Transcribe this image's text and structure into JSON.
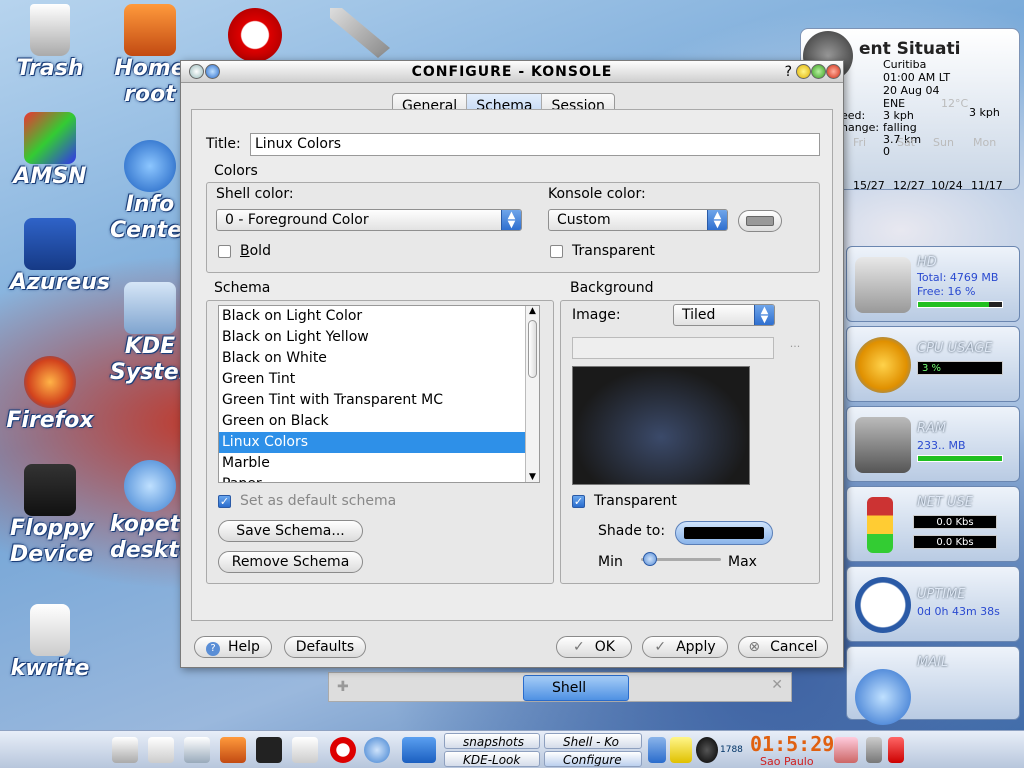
{
  "desktop": {
    "icons": [
      {
        "label": "Trash"
      },
      {
        "label": "Home root"
      },
      {
        "label": "AMSN"
      },
      {
        "label": "Info Center"
      },
      {
        "label": "Azureus"
      },
      {
        "label": "KDE System"
      },
      {
        "label": "Firefox"
      },
      {
        "label": "Floppy Device"
      },
      {
        "label": "kopete desktop"
      },
      {
        "label": "kwrite"
      }
    ]
  },
  "weather": {
    "title": "ent Situati",
    "city": "Curitiba",
    "time": "01:00 AM LT",
    "date": "20 Aug 04",
    "wind_dir": "ENE",
    "temp": "12°C",
    "speed_label": "eed:",
    "speed": "3 kph",
    "change_label": "hange:",
    "change": "falling",
    "visibility": "3.7 km",
    "extra": "0",
    "wind_speed": "3 kph",
    "days": [
      "Fri",
      "Sat",
      "Sun",
      "Mon"
    ],
    "ranges": [
      "15/27",
      "12/27",
      "10/24",
      "11/17"
    ]
  },
  "widgets": {
    "hd": {
      "title": "HD",
      "total": "Total: 4769 MB",
      "free": "Free: 16 %",
      "used_fraction": 0.84
    },
    "cpu": {
      "title": "CPU USAGE",
      "value": "3 %"
    },
    "ram": {
      "title": "RAM",
      "value": "233.. MB"
    },
    "net": {
      "title": "NET USE",
      "down": "0.0 Kbs",
      "up": "0.0 Kbs"
    },
    "uptime": {
      "title": "UPTIME",
      "value": "0d 0h 43m 38s"
    },
    "mail": {
      "title": "MAIL"
    }
  },
  "dialog": {
    "title": "CONFIGURE - KONSOLE",
    "help_glyph": "?",
    "tabs": [
      {
        "pre": "",
        "ul": "G",
        "post": "eneral"
      },
      {
        "pre": "",
        "ul": "S",
        "post": "chema"
      },
      {
        "pre": "",
        "ul": "S",
        "post": "ession"
      }
    ],
    "title_label": "Title:",
    "title_value": "Linux Colors",
    "colors_group": "Colors",
    "shell_color_label": "Shell color:",
    "shell_color_value": "0 - Foreground Color",
    "bold_label": "Bold",
    "konsole_color_label": "Konsole color:",
    "konsole_color_value": "Custom",
    "transparent_label": "Transparent",
    "schema_group": "Schema",
    "schemas": [
      "Black on Light Color",
      "Black on Light Yellow",
      "Black on White",
      "Green Tint",
      "Green Tint with Transparent MC",
      "Green on Black",
      "Linux Colors",
      "Marble",
      "Paper"
    ],
    "selected_schema": "Linux Colors",
    "set_default_label": "Set as default schema",
    "save_schema": "Save Schema...",
    "remove_schema": "Remove Schema",
    "background_group": "Background",
    "image_label": "Image:",
    "image_mode": "Tiled",
    "browse_glyph": "...",
    "bg_transparent_label": "Transparent",
    "shade_to_label": "Shade to:",
    "min_label": "Min",
    "max_label": "Max",
    "help_button": "Help",
    "defaults_button": "Defaults",
    "ok_button": "OK",
    "apply_button": "Apply",
    "cancel_button": "Cancel"
  },
  "konsole_tab": {
    "label": "Shell"
  },
  "taskbar": {
    "tasks": [
      "snapshots",
      "KDE-Look",
      "Shell - Ko",
      "Configure"
    ],
    "clock": "01:5:29",
    "city": "Sao Paulo",
    "counter": "1788"
  }
}
